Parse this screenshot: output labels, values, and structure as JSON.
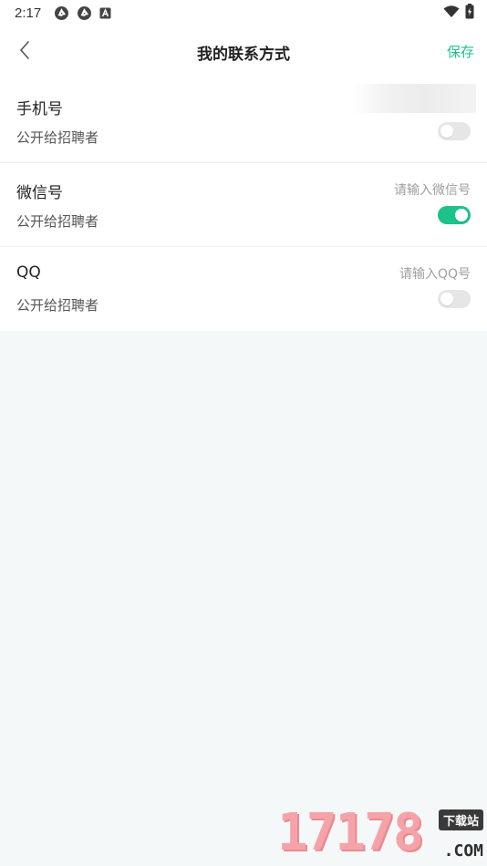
{
  "status_bar": {
    "time": "2:17",
    "icons": [
      "aperture-icon",
      "aperture-icon",
      "a-badge-icon"
    ],
    "right_icons": [
      "wifi-icon",
      "battery-icon"
    ]
  },
  "nav": {
    "back_icon": "chevron-left-icon",
    "title": "我的联系方式",
    "save_label": "保存"
  },
  "contacts": [
    {
      "label": "手机号",
      "public_label": "公开给招聘者",
      "value": "",
      "placeholder": "",
      "value_blurred": true,
      "public": false
    },
    {
      "label": "微信号",
      "public_label": "公开给招聘者",
      "value": "",
      "placeholder": "请输入微信号",
      "value_blurred": false,
      "public": true
    },
    {
      "label": "QQ",
      "public_label": "公开给招聘者",
      "value": "",
      "placeholder": "请输入QQ号",
      "value_blurred": false,
      "public": false
    }
  ],
  "colors": {
    "accent": "#1dc28b",
    "toggle_off": "#e6e6e6",
    "page_bg": "#f5f8f8"
  },
  "watermark": {
    "number": "17178",
    "tag": "下载站",
    "domain": ".COM"
  }
}
